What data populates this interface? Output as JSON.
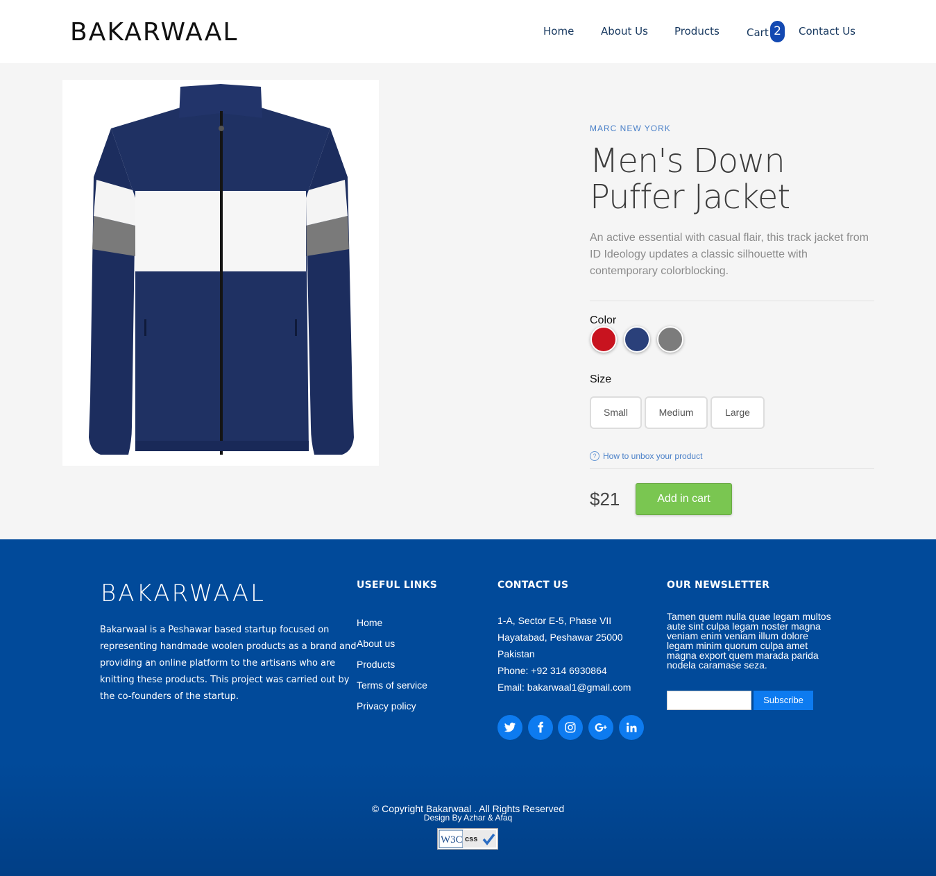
{
  "header": {
    "logo": "BAKARWAAL",
    "nav": [
      {
        "label": "Home"
      },
      {
        "label": "About Us"
      },
      {
        "label": "Products"
      },
      {
        "label": "Cart"
      },
      {
        "label": "Contact Us"
      }
    ],
    "cart_count": "2"
  },
  "product": {
    "brand": "MARC NEW YORK",
    "title": "Men's Down Puffer Jacket",
    "description": "An active essential with casual flair, this track jacket from ID Ideology updates a classic silhouette with contemporary colorblocking.",
    "color_label": "Color",
    "colors": [
      "#c8131f",
      "#2a407a",
      "#7c7c7c"
    ],
    "size_label": "Size",
    "sizes": [
      "Small",
      "Medium",
      "Large"
    ],
    "help_icon": "?",
    "help_link": "How to unbox your product",
    "price": "$21",
    "add_to_cart": "Add in cart"
  },
  "footer": {
    "logo": "BAKARWAAL",
    "about": "Bakarwaal is a Peshawar based startup focused on representing handmade woolen products as a brand and providing an online platform to the artisans who are knitting these products. This project was carried out by the co-founders of the startup.",
    "useful_links_title": "USEFUL LINKS",
    "useful_links": [
      "Home",
      "About us",
      "Products",
      "Terms of service",
      "Privacy policy"
    ],
    "contact_title": "CONTACT US",
    "contact_lines": [
      "1-A, Sector E-5, Phase VII",
      "Hayatabad, Peshawar 25000",
      "Pakistan",
      "Phone: +92 314 6930864",
      "Email: bakarwaal1@gmail.com"
    ],
    "social_icons": [
      "twitter-icon",
      "facebook-icon",
      "instagram-icon",
      "google-plus-icon",
      "linkedin-icon"
    ],
    "newsletter_title": "OUR NEWSLETTER",
    "newsletter_text": "Tamen quem nulla quae legam multos aute sint culpa legam noster magna veniam enim veniam illum dolore legam minim quorum culpa amet magna export quem marada parida nodela caramase seza.",
    "newsletter_placeholder": "",
    "subscribe": "Subscribe",
    "copyright": "© Copyright Bakarwaal . All Rights Reserved",
    "credits": "Design By Azhar & Afaq",
    "w3c_badge": [
      "W3C",
      "css"
    ]
  },
  "colors": {
    "nav_text": "#17385f",
    "footer_bg": "#014a9a",
    "accent_button": "#7ac651",
    "social_bg": "#0d7bf0"
  }
}
